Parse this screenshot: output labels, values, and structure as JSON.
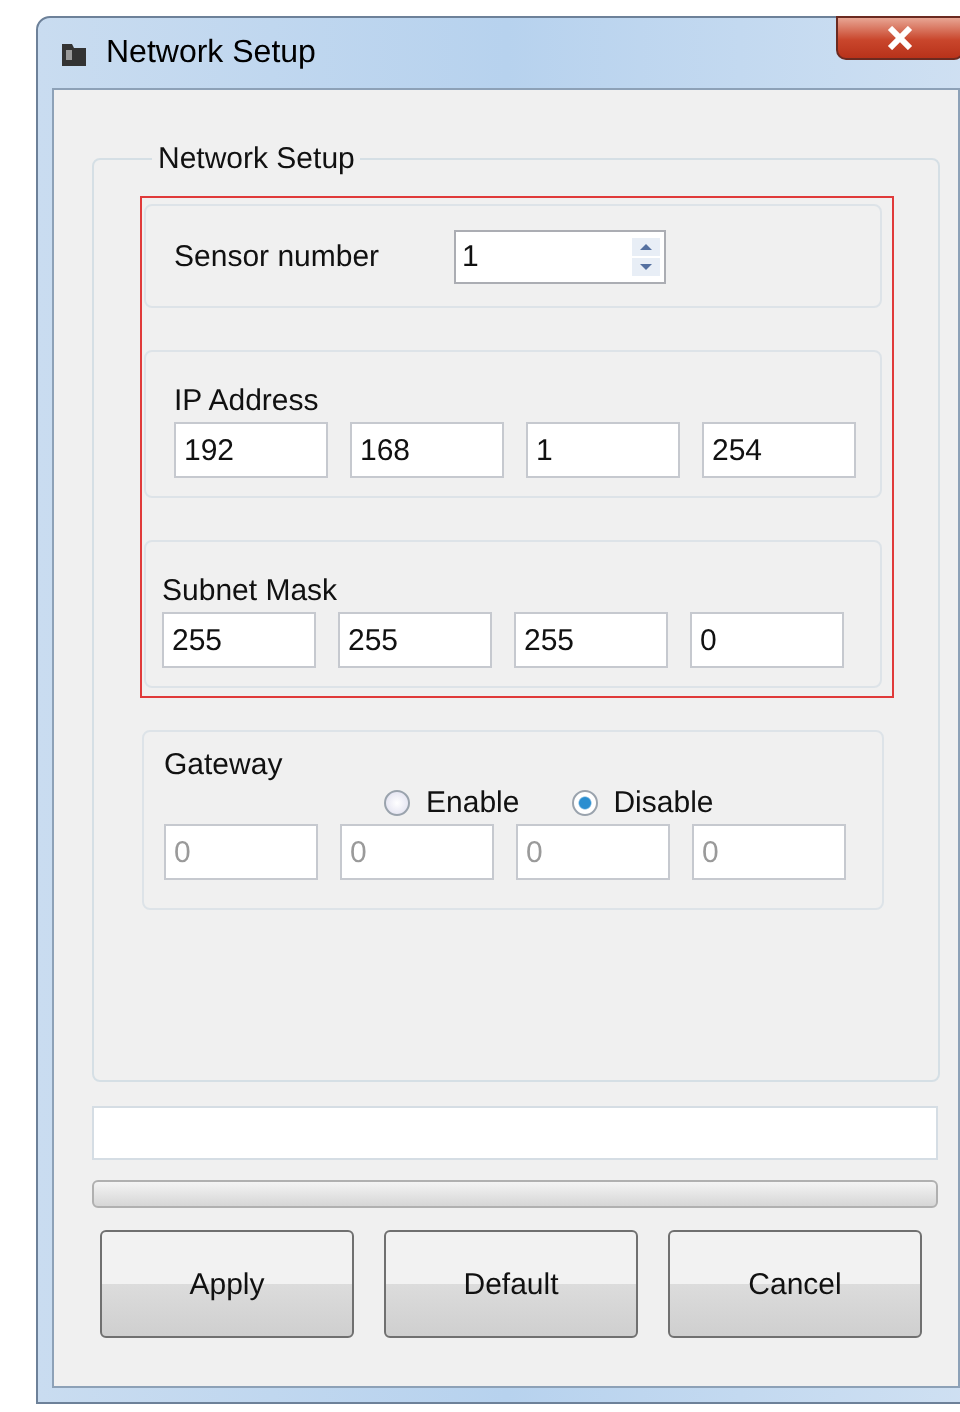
{
  "window": {
    "title": "Network Setup"
  },
  "group": {
    "title": "Network Setup"
  },
  "sensor": {
    "label": "Sensor number",
    "value": "1"
  },
  "ip": {
    "label": "IP Address",
    "octets": [
      "192",
      "168",
      "1",
      "254"
    ]
  },
  "subnet": {
    "label": "Subnet Mask",
    "octets": [
      "255",
      "255",
      "255",
      "0"
    ]
  },
  "gateway": {
    "label": "Gateway",
    "options": [
      {
        "label": "Enable",
        "selected": false
      },
      {
        "label": "Disable",
        "selected": true
      }
    ],
    "disabled": true,
    "octets": [
      "0",
      "0",
      "0",
      "0"
    ]
  },
  "progress": {
    "level": 0
  },
  "buttons": [
    "Apply",
    "Default",
    "Cancel"
  ]
}
